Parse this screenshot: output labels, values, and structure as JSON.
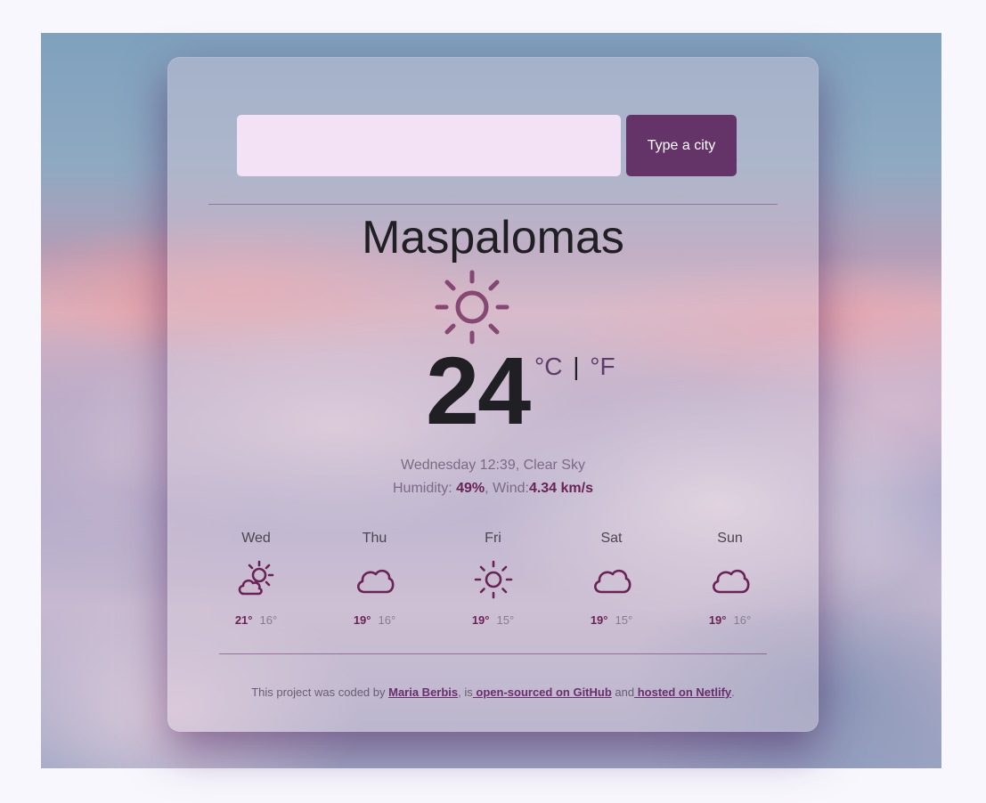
{
  "search": {
    "input_value": "",
    "input_placeholder": "",
    "button_label": "Type a city"
  },
  "current": {
    "city": "Maspalomas",
    "icon": "sun-icon",
    "temperature": "24",
    "unit_celsius": "°C",
    "unit_separator": "|",
    "unit_fahrenheit": "°F",
    "description": "Wednesday 12:39, Clear Sky",
    "humidity_label": "Humidity: ",
    "humidity_value": "49%",
    "wind_label": ", Wind:",
    "wind_value": "4.34 km/s"
  },
  "forecast": [
    {
      "day": "Wed",
      "icon": "partly-cloudy-icon",
      "max": "21°",
      "min": "16°"
    },
    {
      "day": "Thu",
      "icon": "cloud-icon",
      "max": "19°",
      "min": "16°"
    },
    {
      "day": "Fri",
      "icon": "sun-icon",
      "max": "19°",
      "min": "15°"
    },
    {
      "day": "Sat",
      "icon": "cloud-icon",
      "max": "19°",
      "min": "15°"
    },
    {
      "day": "Sun",
      "icon": "cloud-icon",
      "max": "19°",
      "min": "16°"
    }
  ],
  "footer": {
    "prefix": "This project was coded by ",
    "author_link": "Maria Berbis",
    "middle1": ", is",
    "github_link": " open-sourced on GitHub",
    "middle2": " and",
    "netlify_link": " hosted on Netlify",
    "suffix": "."
  },
  "colors": {
    "accent": "#643469",
    "input_bg": "#f3e2f6",
    "icon_stroke": "#6a2356"
  }
}
